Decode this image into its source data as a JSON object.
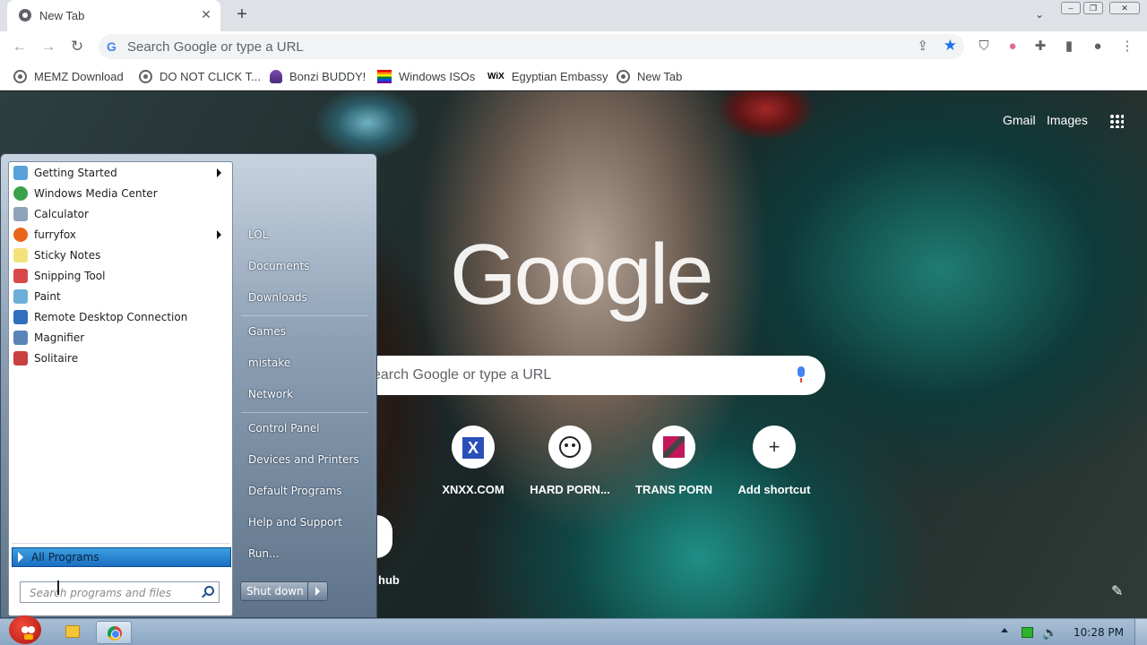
{
  "browser": {
    "tab": {
      "title": "New Tab",
      "close_icon": "close-icon"
    },
    "omnibox": {
      "placeholder": "Search Google or type a URL"
    },
    "bookmarks": [
      {
        "label": "MEMZ Download",
        "icon": "globe-icon"
      },
      {
        "label": "DO NOT CLICK T...",
        "icon": "globe-icon"
      },
      {
        "label": "Bonzi BUDDY!",
        "icon": "bonzi-icon"
      },
      {
        "label": "Windows ISOs",
        "icon": "rainbow-flag-icon"
      },
      {
        "label": "Egyptian Embassy",
        "icon": "wix-icon"
      },
      {
        "label": "New Tab",
        "icon": "globe-icon"
      }
    ]
  },
  "newtab": {
    "gmail": "Gmail",
    "images": "Images",
    "logo": "Google",
    "search_placeholder": "earch Google or type a URL",
    "shortcuts": [
      {
        "label": "hub"
      },
      {
        "label": "XNXX.COM"
      },
      {
        "label": "HARD PORN..."
      },
      {
        "label": "TRANS PORN"
      },
      {
        "label": "Add shortcut"
      }
    ]
  },
  "startmenu": {
    "programs": [
      {
        "label": "Getting Started",
        "submenu": true,
        "color": "#5aa0d8"
      },
      {
        "label": "Windows Media Center",
        "submenu": false,
        "color": "#3aa14a"
      },
      {
        "label": "Calculator",
        "submenu": false,
        "color": "#8fa3b8"
      },
      {
        "label": "furryfox",
        "submenu": true,
        "color": "#e8661c"
      },
      {
        "label": "Sticky Notes",
        "submenu": false,
        "color": "#f3e27a"
      },
      {
        "label": "Snipping Tool",
        "submenu": false,
        "color": "#d84a4a"
      },
      {
        "label": "Paint",
        "submenu": false,
        "color": "#6ab0d9"
      },
      {
        "label": "Remote Desktop Connection",
        "submenu": false,
        "color": "#2f6fbf"
      },
      {
        "label": "Magnifier",
        "submenu": false,
        "color": "#5a84b8"
      },
      {
        "label": "Solitaire",
        "submenu": false,
        "color": "#c94040"
      }
    ],
    "all_programs": "All Programs",
    "search_placeholder": "Search programs and files",
    "places": [
      {
        "label": "LOL"
      },
      {
        "label": "Documents"
      },
      {
        "label": "Downloads"
      },
      {
        "label": "Games"
      },
      {
        "label": "mistake"
      },
      {
        "label": "Network"
      },
      {
        "label": "Control Panel"
      },
      {
        "label": "Devices and Printers"
      },
      {
        "label": "Default Programs"
      },
      {
        "label": "Help and Support"
      },
      {
        "label": "Run..."
      }
    ],
    "shutdown": "Shut down"
  },
  "taskbar": {
    "clock": "10:28 PM"
  }
}
